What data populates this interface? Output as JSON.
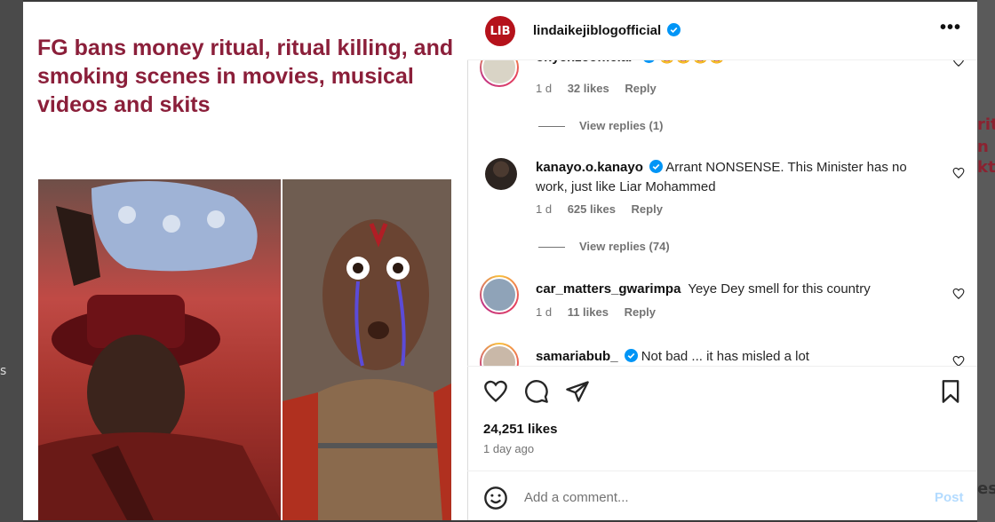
{
  "backdrop": {
    "left_text": "s",
    "right_texts": [
      "rit",
      "n",
      "kts",
      "esp"
    ]
  },
  "post": {
    "headline": "FG bans money ritual, ritual killing, and smoking scenes in movies, musical videos and skits"
  },
  "header": {
    "avatar_text": "LIB",
    "username": "lindaikejiblogofficial",
    "more_label": "•••"
  },
  "comments": [
    {
      "username": "onyenzeofficial",
      "text": "😂😂😂😂",
      "verified": true,
      "time": "1 d",
      "likes": "32 likes",
      "reply": "Reply",
      "view_replies": "View replies (1)"
    },
    {
      "username": "kanayo.o.kanayo",
      "text": "Arrant NONSENSE. This Minister has no work, just like Liar Mohammed",
      "verified": true,
      "time": "1 d",
      "likes": "625 likes",
      "reply": "Reply",
      "view_replies": "View replies (74)"
    },
    {
      "username": "car_matters_gwarimpa",
      "text": "Yeye Dey smell for this country",
      "verified": false,
      "time": "1 d",
      "likes": "11 likes",
      "reply": "Reply"
    },
    {
      "username": "samariabub_",
      "text": "Not bad ... it has misled a lot",
      "verified": true
    }
  ],
  "footer": {
    "likes": "24,251 likes",
    "time_ago": "1 day ago",
    "comment_placeholder": "Add a comment...",
    "post_label": "Post"
  },
  "colors": {
    "headline": "#8b1f3a",
    "verified": "#0095f6",
    "brand": "#b5121b"
  }
}
